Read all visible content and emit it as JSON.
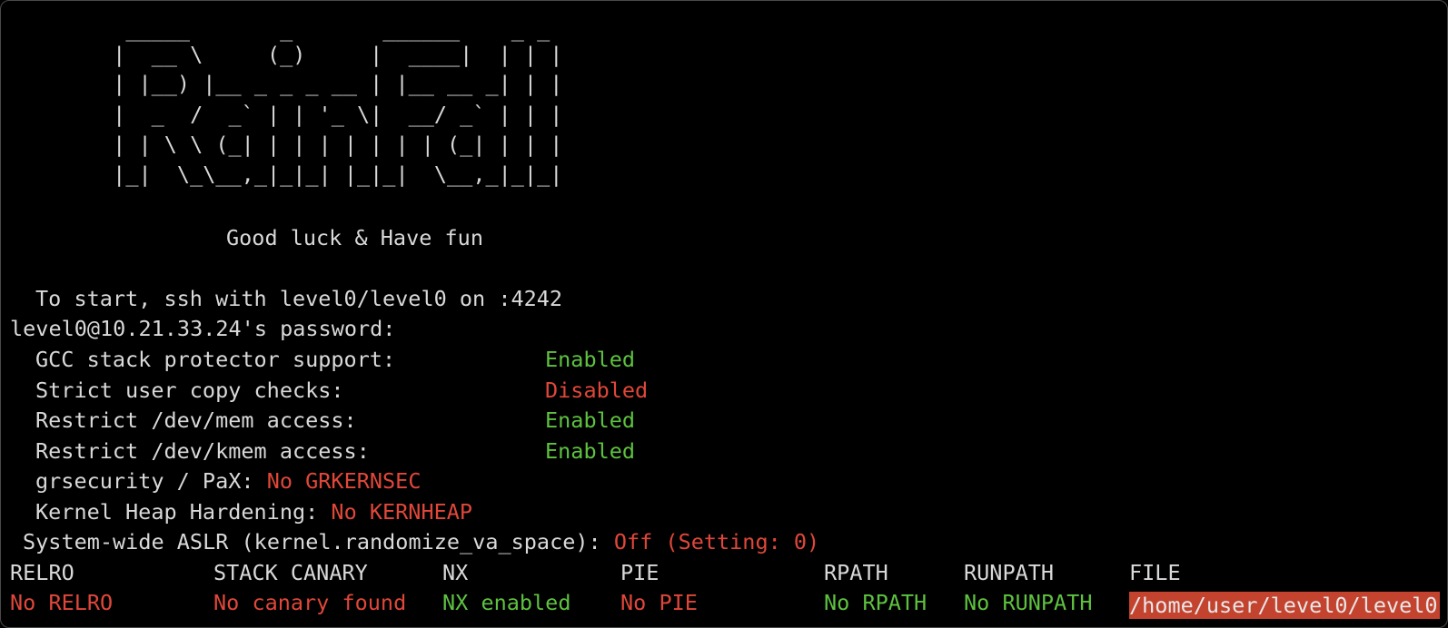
{
  "banner": {
    "lines": [
      "         _____       _       ______    _ _ ",
      "        |  __ \\     (_)     |  ____|  | | |",
      "        | |__) |__ _ _ _ __ | |__ __ _| | |",
      "        |  _  /  _` | | '_ \\|  __/ _` | | |",
      "        | | \\ \\ (_| | | | | | | | (_| | | |",
      "        |_|  \\_\\__,_|_|_| |_|_|  \\__,_|_|_|"
    ],
    "tagline": "Good luck & Have fun"
  },
  "session": {
    "instructions": "To start, ssh with level0/level0 on :4242",
    "password_prompt": "level0@10.21.33.24's password:"
  },
  "kernel_checks": [
    {
      "label": "GCC stack protector support:",
      "value": "Enabled",
      "status": "green"
    },
    {
      "label": "Strict user copy checks:",
      "value": "Disabled",
      "status": "red"
    },
    {
      "label": "Restrict /dev/mem access:",
      "value": "Enabled",
      "status": "green"
    },
    {
      "label": "Restrict /dev/kmem access:",
      "value": "Enabled",
      "status": "green"
    }
  ],
  "inline_checks": [
    {
      "label": "grsecurity / PaX:",
      "value": "No GRKERNSEC",
      "status": "red"
    },
    {
      "label": "Kernel Heap Hardening:",
      "value": "No KERNHEAP",
      "status": "red"
    }
  ],
  "aslr": {
    "label": "System-wide ASLR (kernel.randomize_va_space):",
    "value": "Off (Setting: 0)",
    "status": "red"
  },
  "checksec": {
    "headers": [
      "RELRO",
      "STACK CANARY",
      "NX",
      "PIE",
      "RPATH",
      "RUNPATH",
      "FILE"
    ],
    "values": [
      {
        "text": "No RELRO",
        "status": "red"
      },
      {
        "text": "No canary found",
        "status": "red"
      },
      {
        "text": "NX enabled",
        "status": "green"
      },
      {
        "text": "No PIE",
        "status": "red"
      },
      {
        "text": "No RPATH",
        "status": "green"
      },
      {
        "text": "No RUNPATH",
        "status": "green"
      },
      {
        "text": "/home/user/level0/level0",
        "status": "highlight"
      }
    ]
  },
  "colors": {
    "background": "#000000",
    "text": "#d9d9d9",
    "green": "#5ec23f",
    "red": "#e0473a",
    "highlight_bg": "#c4432f"
  }
}
